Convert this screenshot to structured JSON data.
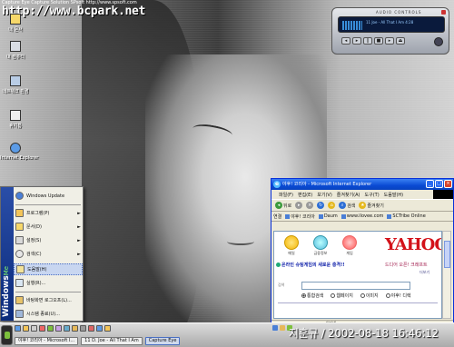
{
  "caption": {
    "capture_text": "Capture Eye  Capture Solution  SPsoft  http://www.spsoft.com",
    "site_url": "http://www.bcpark.net"
  },
  "desktop_icons": [
    {
      "name": "my-documents",
      "label": "내 문서"
    },
    {
      "name": "my-computer",
      "label": "내 컴퓨터"
    },
    {
      "name": "network-places",
      "label": "네트워크 환경"
    },
    {
      "name": "recycle-bin",
      "label": "휴지통"
    },
    {
      "name": "internet-explorer",
      "label": "Internet Explorer"
    }
  ],
  "player": {
    "title": "AUDIO CONTROLS",
    "track": "11 Joe - All That I Am 4:28"
  },
  "ie": {
    "title": "야후! 코리아 - Microsoft Internet Explorer",
    "menu": [
      "파일(F)",
      "편집(E)",
      "보기(V)",
      "즐겨찾기(A)",
      "도구(T)",
      "도움말(H)"
    ],
    "toolbar": {
      "back": "뒤로",
      "forward": "",
      "search": "검색",
      "favorites": "즐겨찾기"
    },
    "links": {
      "address_label": "연결",
      "items": [
        "야후! 코리아",
        "Daum",
        "www.ilovee.com",
        "SCTribe Online"
      ]
    },
    "content": {
      "icons": [
        "메일",
        "금융정보",
        "게임"
      ],
      "logo": "YAHOO! Ko",
      "promo_text": "온라인 슈팅게임의 새로운 충격!!",
      "promo_side": "드디어 오픈! 크래프트",
      "more": "더보기",
      "search_label": "검색",
      "radios": [
        {
          "label": "통합검색",
          "checked": true
        },
        {
          "label": "웹페이지",
          "checked": false
        },
        {
          "label": "이미지",
          "checked": false
        },
        {
          "label": "야후! 디렉",
          "checked": false
        }
      ],
      "status": "인터넷"
    },
    "colors": {
      "titlebar": "#0a4bd4",
      "logo": "#d3121a"
    }
  },
  "start_menu": {
    "banner_brand": "Windows",
    "banner_edition": "Me",
    "items": [
      {
        "label": "Windows Update",
        "arrow": ""
      },
      {
        "label": "프로그램(P)",
        "arrow": "►"
      },
      {
        "label": "문서(D)",
        "arrow": "►"
      },
      {
        "label": "설정(S)",
        "arrow": "►"
      },
      {
        "label": "검색(C)",
        "arrow": "►"
      },
      {
        "label": "도움말(H)",
        "arrow": ""
      },
      {
        "label": "실행(R)...",
        "arrow": ""
      },
      {
        "label": "바탕화면 로그오프(L)...",
        "arrow": ""
      },
      {
        "label": "시스템 종료(U)...",
        "arrow": ""
      }
    ],
    "highlighted_index": 5
  },
  "taskbar": {
    "buttons": [
      {
        "label": "야후! 코리아 - Microsoft I...",
        "active": false
      },
      {
        "label": "11 D. Joe - All That I Am",
        "active": false
      },
      {
        "label": "Capture Eye",
        "active": true
      }
    ]
  },
  "stamp": {
    "text": "지훈규 / 2002-08-18 16:46:12"
  }
}
